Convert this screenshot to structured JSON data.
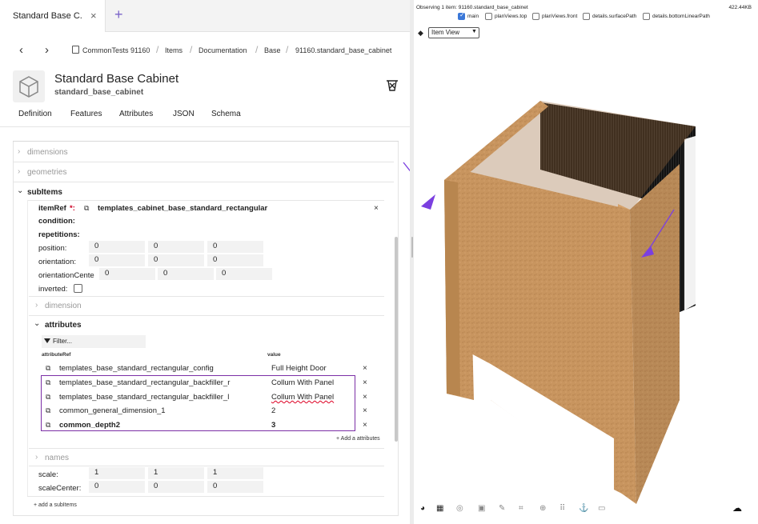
{
  "tabs": {
    "active_label": "Standard Base C...",
    "close": "×",
    "add": "+"
  },
  "nav": {
    "back": "‹",
    "forward": "›"
  },
  "breadcrumb": [
    "CommonTests 91160",
    "Items",
    "Documentation",
    "Base",
    "91160.standard_base_cabinet"
  ],
  "breadcrumb_sep": "/",
  "item": {
    "title": "Standard Base Cabinet",
    "subtitle": "standard_base_cabinet"
  },
  "subtabs": [
    "Definition",
    "Features",
    "Attributes",
    "JSON",
    "Schema"
  ],
  "tree": {
    "dimensions": "dimensions",
    "geometries": "geometries",
    "subitems": "subItems",
    "itemref_label": "itemRef",
    "itemref_req": "*:",
    "itemref_value": "templates_cabinet_base_standard_rectangular",
    "condition": "condition:",
    "repetitions": "repetitions:",
    "position": {
      "label": "position:",
      "values": [
        "0",
        "0",
        "0"
      ]
    },
    "orientation": {
      "label": "orientation:",
      "values": [
        "0",
        "0",
        "0"
      ]
    },
    "orientation_center": {
      "label": "orientationCente",
      "values": [
        "0",
        "0",
        "0"
      ]
    },
    "inverted": "inverted:",
    "dimension": "dimension",
    "attributes": "attributes",
    "filter_placeholder": "Filter...",
    "col_attr": "attributeRef",
    "col_value": "value",
    "attribute_rows": [
      {
        "ref": "templates_base_standard_rectangular_config",
        "value": "Full Height Door"
      },
      {
        "ref": "templates_base_standard_rectangular_backfiller_r",
        "value": "Collum With Panel"
      },
      {
        "ref": "templates_base_standard_rectangular_backfiller_l",
        "value": "Collum With Panel"
      },
      {
        "ref": "common_general_dimension_1",
        "value": "2"
      },
      {
        "ref": "common_depth2",
        "value": "3"
      }
    ],
    "add_attribute": "+ Add a attributes",
    "names": "names",
    "scale": {
      "label": "scale:",
      "values": [
        "1",
        "1",
        "1"
      ]
    },
    "scale_center": {
      "label": "scaleCenter:",
      "values": [
        "0",
        "0",
        "0"
      ]
    },
    "add_subitem": "+ add a subItems",
    "close": "×"
  },
  "viewer": {
    "observing": "Observing 1 item: 91160.standard_base_cabinet",
    "size": "422.44KB",
    "views": [
      {
        "label": "main",
        "checked": true
      },
      {
        "label": "planViews.top",
        "checked": false
      },
      {
        "label": "planViews.front",
        "checked": false
      },
      {
        "label": "details.surfacePath",
        "checked": false
      },
      {
        "label": "details.bottomLinearPath",
        "checked": false
      }
    ],
    "view_mode": "Item View",
    "colors": {
      "wood": "#c8955f",
      "wood_dark": "#a97a48",
      "panel": "#1a1a1a",
      "annotation": "#7b3fe0"
    }
  }
}
